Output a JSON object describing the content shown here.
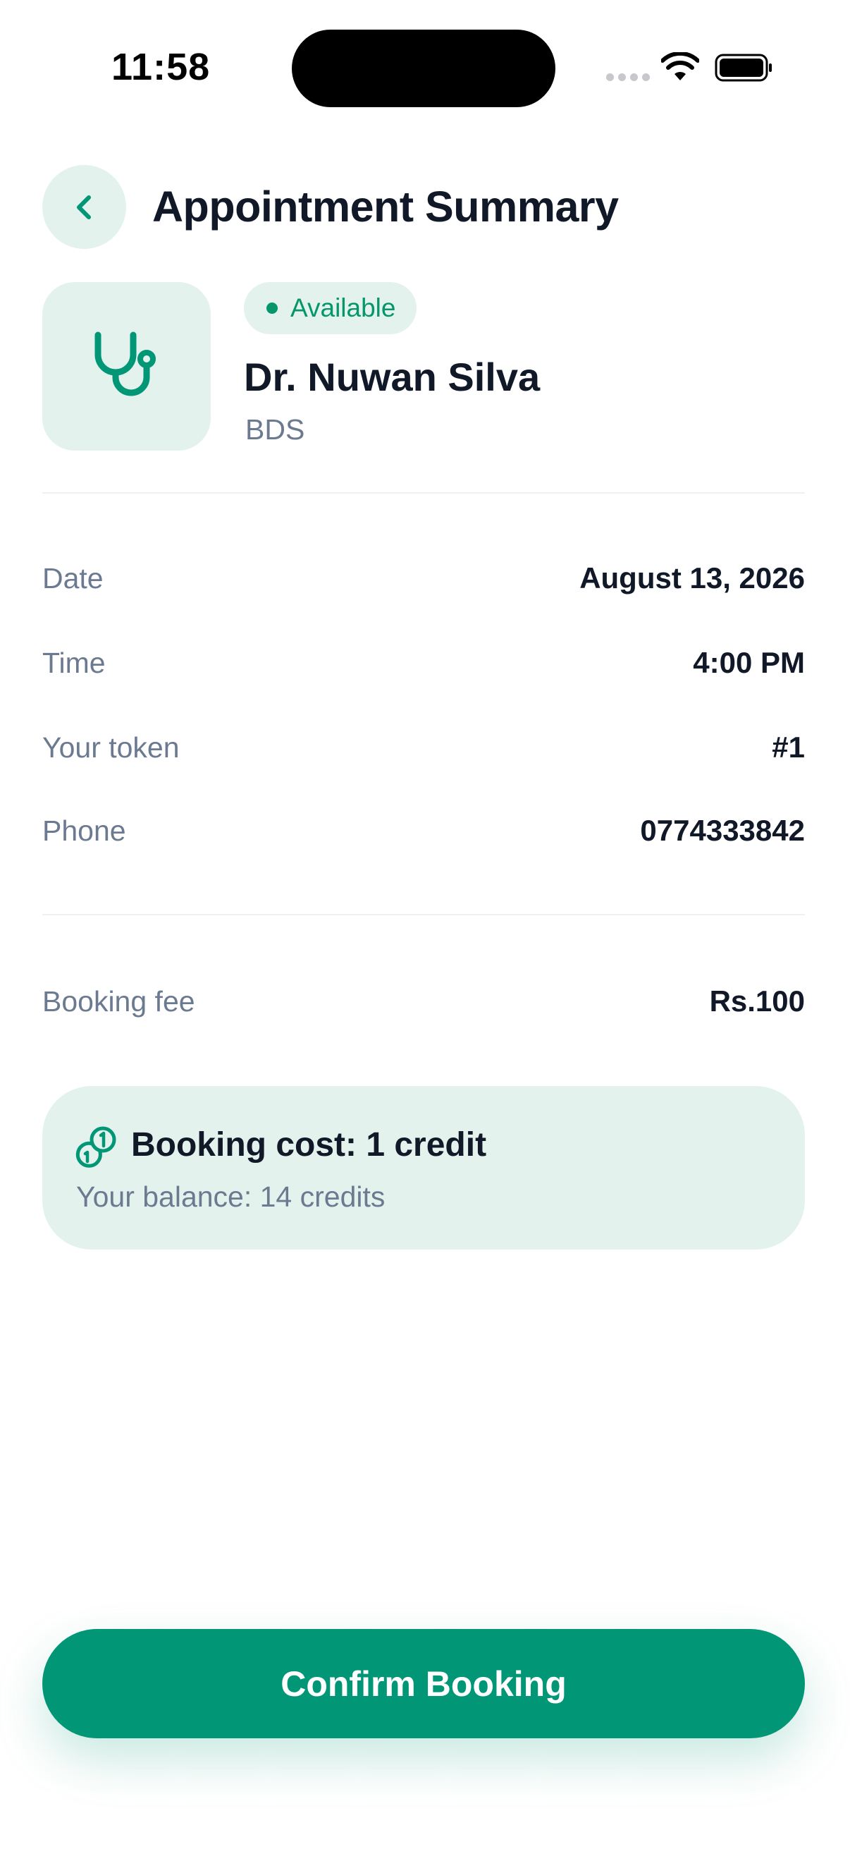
{
  "status_bar": {
    "time": "11:58"
  },
  "header": {
    "title": "Appointment Summary",
    "back_icon": "chevron-left-icon"
  },
  "doctor": {
    "status": "Available",
    "name": "Dr. Nuwan Silva",
    "qualification": "BDS",
    "avatar_icon": "stethoscope-icon"
  },
  "details": [
    {
      "label": "Date",
      "value": "August 13, 2026"
    },
    {
      "label": "Time",
      "value": "4:00 PM"
    },
    {
      "label": "Your token",
      "value": "#1"
    },
    {
      "label": "Phone",
      "value": "0774333842"
    }
  ],
  "fee": {
    "label": "Booking fee",
    "value": "Rs.100"
  },
  "cost": {
    "title": "Booking cost: 1 credit",
    "balance": "Your balance: 14 credits",
    "icon": "coins-icon"
  },
  "actions": {
    "confirm_label": "Confirm Booking"
  },
  "colors": {
    "accent": "#019676",
    "accent_soft": "#e4f2ed",
    "text_primary": "#111827",
    "text_secondary": "#6b7a90"
  }
}
